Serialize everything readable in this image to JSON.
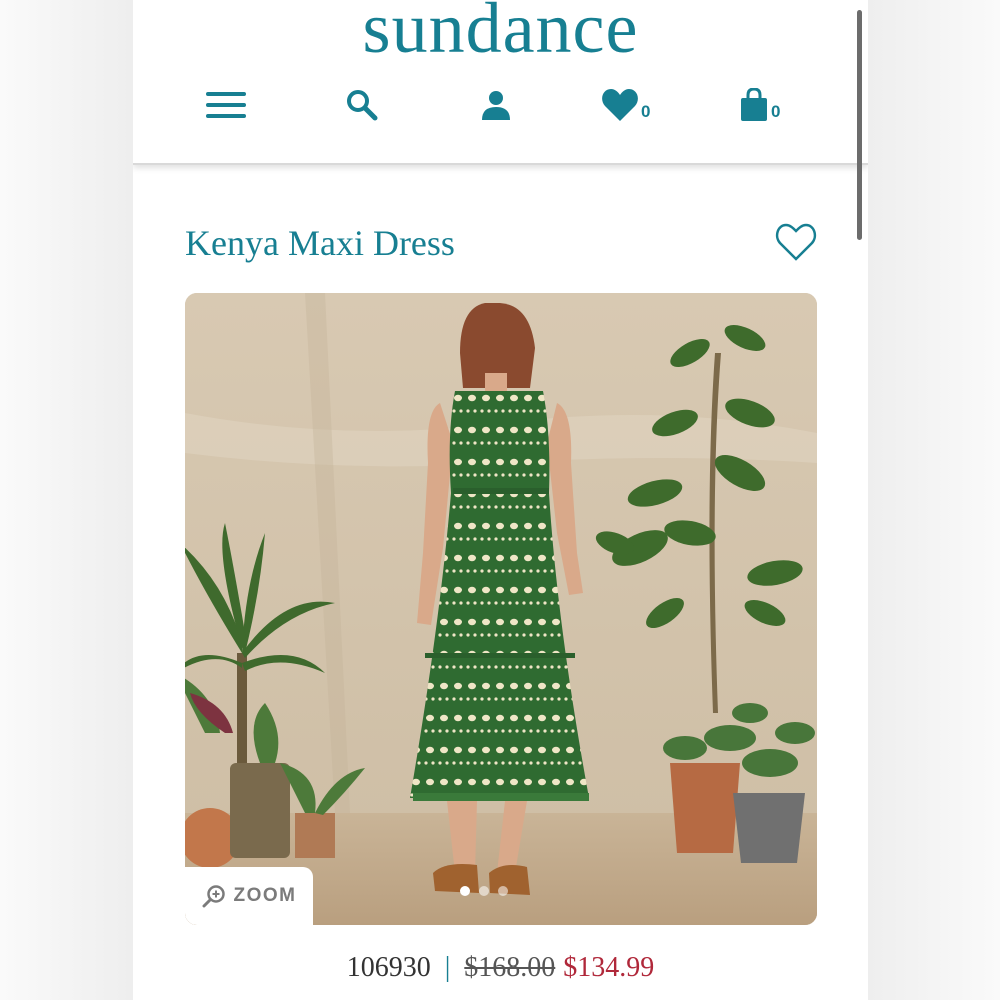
{
  "brand": {
    "logo_text": "sundance",
    "color": "#177f92"
  },
  "nav": {
    "menu_icon": "hamburger-menu-icon",
    "search_icon": "search-icon",
    "account_icon": "user-icon",
    "wishlist_icon": "heart-icon",
    "wishlist_count": "0",
    "bag_icon": "shopping-bag-icon",
    "bag_count": "0"
  },
  "product": {
    "title": "Kenya Maxi Dress",
    "favorite_icon": "heart-outline-icon",
    "image_alt": "Model wearing green dotted tiered maxi dress among potted plants",
    "zoom_label": "ZOOM",
    "carousel": {
      "total": 3,
      "active": 0
    },
    "sku": "106930",
    "original_price": "$168.00",
    "sale_price": "$134.99",
    "sale_color": "#b0283a"
  }
}
